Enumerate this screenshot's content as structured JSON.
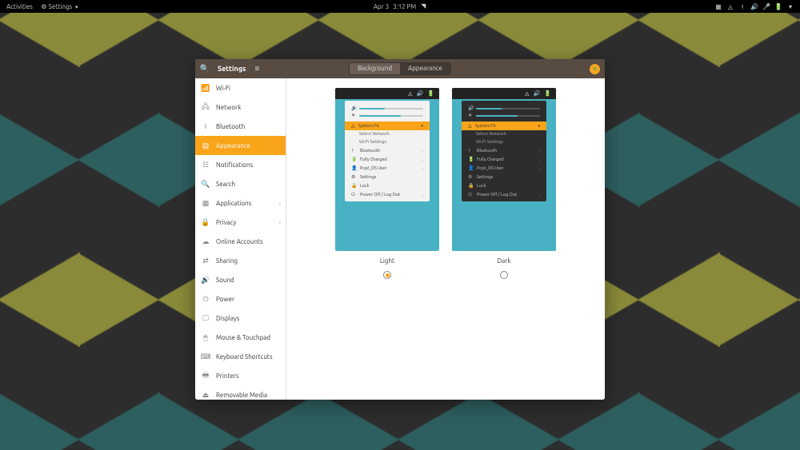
{
  "topbar": {
    "activities": "Activities",
    "app": "Settings",
    "date": "Apr 3",
    "time": "3:12 PM"
  },
  "window": {
    "title": "Settings",
    "tabs": {
      "background": "Background",
      "appearance": "Appearance"
    }
  },
  "sidebar": {
    "items": [
      {
        "icon": "wifi",
        "label": "Wi-Fi"
      },
      {
        "icon": "network",
        "label": "Network"
      },
      {
        "icon": "bluetooth",
        "label": "Bluetooth"
      },
      {
        "icon": "appearance",
        "label": "Appearance"
      },
      {
        "icon": "bell",
        "label": "Notifications"
      },
      {
        "icon": "search",
        "label": "Search"
      },
      {
        "icon": "grid",
        "label": "Applications",
        "chev": true
      },
      {
        "icon": "lock",
        "label": "Privacy",
        "chev": true
      },
      {
        "icon": "cloud",
        "label": "Online Accounts"
      },
      {
        "icon": "share",
        "label": "Sharing"
      },
      {
        "icon": "speaker",
        "label": "Sound"
      },
      {
        "icon": "power",
        "label": "Power"
      },
      {
        "icon": "display",
        "label": "Displays"
      },
      {
        "icon": "mouse",
        "label": "Mouse & Touchpad"
      },
      {
        "icon": "keyboard",
        "label": "Keyboard Shortcuts"
      },
      {
        "icon": "printer",
        "label": "Printers"
      },
      {
        "icon": "usb",
        "label": "Removable Media"
      }
    ],
    "active": 3
  },
  "themes": {
    "light": "Light",
    "dark": "Dark",
    "selected": "light"
  },
  "preview": {
    "network": "System76",
    "sub1": "Select Network",
    "sub2": "Wi-Fi Settings",
    "rows": [
      {
        "icon": "bt",
        "label": "Bluetooth",
        "chev": true
      },
      {
        "icon": "bat",
        "label": "Fully Charged",
        "chev": true
      },
      {
        "icon": "user",
        "label": "Pop!_OS User",
        "chev": true
      },
      {
        "icon": "gear",
        "label": "Settings"
      },
      {
        "icon": "lock",
        "label": "Lock"
      },
      {
        "icon": "power",
        "label": "Power Off / Log Out",
        "chev": true
      }
    ]
  }
}
